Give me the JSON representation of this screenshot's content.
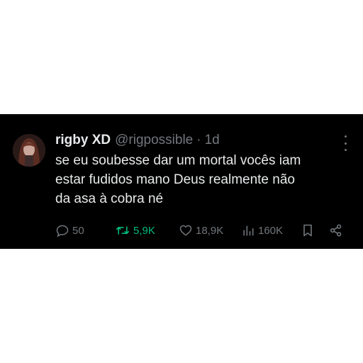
{
  "tweet": {
    "display_name": "rigby XD",
    "handle": "@rigpossible",
    "separator": "·",
    "timestamp": "1d",
    "text_lines": [
      "se eu soubesse dar um mortal vocês iam",
      "estar fudidos mano Deus realmente não",
      "da asa à cobra né"
    ]
  },
  "actions": {
    "replies": "50",
    "retweets": "5,9K",
    "likes": "18,9K",
    "views": "160K"
  },
  "icons": {
    "reply": "reply-icon",
    "retweet": "retweet-icon",
    "like": "heart-icon",
    "views": "views-icon",
    "bookmark": "bookmark-icon",
    "share": "share-icon",
    "more": "more-icon"
  },
  "colors": {
    "background": "#000000",
    "text": "#e7e9ea",
    "muted": "#71767b",
    "retweet_active": "#00ba7c"
  }
}
